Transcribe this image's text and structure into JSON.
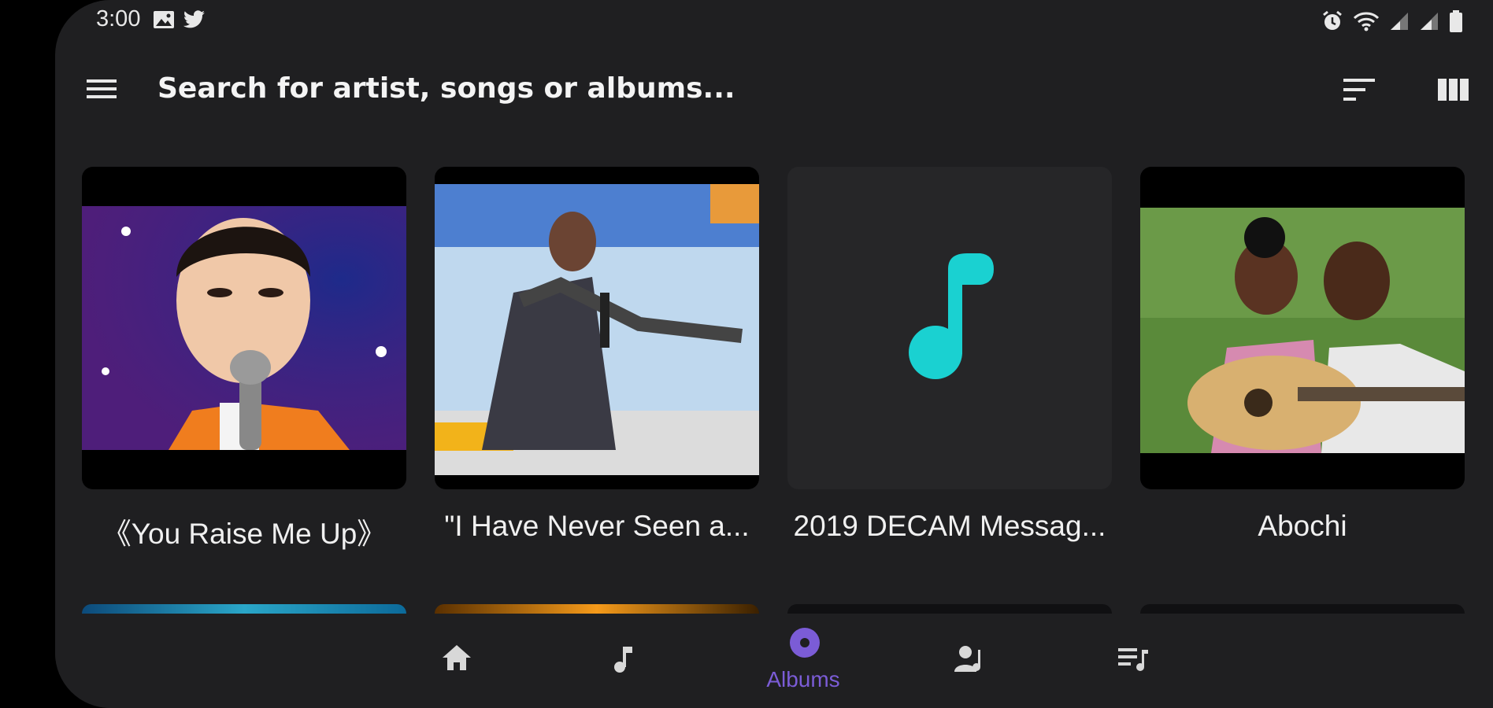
{
  "status_bar": {
    "time": "3:00",
    "left_icons": [
      "image-icon",
      "twitter-icon"
    ],
    "right_icons": [
      "alarm-icon",
      "wifi-icon",
      "signal-icon",
      "signal-icon",
      "battery-icon"
    ]
  },
  "toolbar": {
    "menu_icon": "hamburger-menu-icon",
    "search_placeholder": "Search for artist, songs or albums...",
    "sort_icon": "sort-icon",
    "grid_icon": "grid-view-icon"
  },
  "albums": [
    {
      "title": "《You Raise Me Up》",
      "art": "photo-boy-singing"
    },
    {
      "title": "\"I Have Never Seen a...",
      "art": "photo-preacher"
    },
    {
      "title": "2019 DECAM Messag...",
      "art": "music-note-placeholder"
    },
    {
      "title": "Abochi",
      "art": "photo-couple-guitar"
    }
  ],
  "bottom_nav": {
    "items": [
      {
        "icon": "home-icon",
        "label": ""
      },
      {
        "icon": "music-note-icon",
        "label": ""
      },
      {
        "icon": "album-icon",
        "label": "Albums",
        "active": true
      },
      {
        "icon": "artist-icon",
        "label": ""
      },
      {
        "icon": "playlist-icon",
        "label": ""
      }
    ]
  },
  "colors": {
    "background": "#1f1f21",
    "accent": "#7b5cd6",
    "note_icon": "#1ad1d1",
    "text": "#f0f0f0"
  }
}
